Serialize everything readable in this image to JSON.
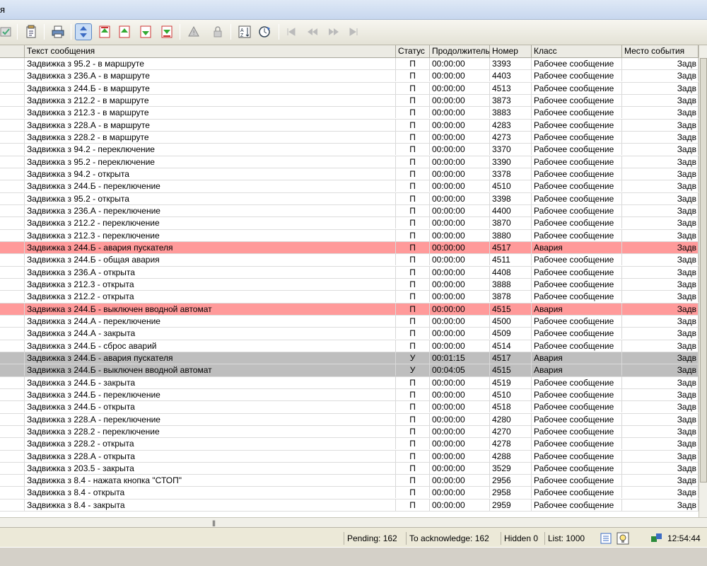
{
  "window": {
    "title": "я"
  },
  "toolbar": {
    "icons": [
      "check-list-icon",
      "properties-icon",
      "print-icon",
      "autoscroll-icon",
      "first-page-icon",
      "previous-page-icon",
      "next-page-icon",
      "last-page-icon",
      "alarm-bell-icon",
      "lock-icon",
      "sort-icon",
      "time-jump-icon",
      "nav-first-icon",
      "nav-prev-icon",
      "nav-next-icon",
      "nav-last-icon"
    ]
  },
  "columns": [
    "",
    "Текст сообщения",
    "Статус",
    "Продолжительность",
    "Номер",
    "Класс",
    "Место события"
  ],
  "rows": [
    {
      "text": "Задвижка з 95.2 - в маршруте",
      "status": "П",
      "duration": "00:00:00",
      "number": "3393",
      "cls": "Рабочее сообщение",
      "place": "Задв",
      "kind": "normal"
    },
    {
      "text": "Задвижка з 236.А - в маршруте",
      "status": "П",
      "duration": "00:00:00",
      "number": "4403",
      "cls": "Рабочее сообщение",
      "place": "Задв",
      "kind": "normal"
    },
    {
      "text": "Задвижка з 244.Б - в маршруте",
      "status": "П",
      "duration": "00:00:00",
      "number": "4513",
      "cls": "Рабочее сообщение",
      "place": "Задв",
      "kind": "normal"
    },
    {
      "text": "Задвижка з 212.2 - в маршруте",
      "status": "П",
      "duration": "00:00:00",
      "number": "3873",
      "cls": "Рабочее сообщение",
      "place": "Задв",
      "kind": "normal"
    },
    {
      "text": "Задвижка з 212.3 - в маршруте",
      "status": "П",
      "duration": "00:00:00",
      "number": "3883",
      "cls": "Рабочее сообщение",
      "place": "Задв",
      "kind": "normal"
    },
    {
      "text": "Задвижка з 228.А - в маршруте",
      "status": "П",
      "duration": "00:00:00",
      "number": "4283",
      "cls": "Рабочее сообщение",
      "place": "Задв",
      "kind": "normal"
    },
    {
      "text": "Задвижка з 228.2 - в маршруте",
      "status": "П",
      "duration": "00:00:00",
      "number": "4273",
      "cls": "Рабочее сообщение",
      "place": "Задв",
      "kind": "normal"
    },
    {
      "text": "Задвижка з 94.2 - переключение",
      "status": "П",
      "duration": "00:00:00",
      "number": "3370",
      "cls": "Рабочее сообщение",
      "place": "Задв",
      "kind": "normal"
    },
    {
      "text": "Задвижка з 95.2 - переключение",
      "status": "П",
      "duration": "00:00:00",
      "number": "3390",
      "cls": "Рабочее сообщение",
      "place": "Задв",
      "kind": "normal"
    },
    {
      "text": "Задвижка з 94.2 - открыта",
      "status": "П",
      "duration": "00:00:00",
      "number": "3378",
      "cls": "Рабочее сообщение",
      "place": "Задв",
      "kind": "normal"
    },
    {
      "text": "Задвижка з 244.Б - переключение",
      "status": "П",
      "duration": "00:00:00",
      "number": "4510",
      "cls": "Рабочее сообщение",
      "place": "Задв",
      "kind": "normal"
    },
    {
      "text": "Задвижка з 95.2 - открыта",
      "status": "П",
      "duration": "00:00:00",
      "number": "3398",
      "cls": "Рабочее сообщение",
      "place": "Задв",
      "kind": "normal"
    },
    {
      "text": "Задвижка з 236.А - переключение",
      "status": "П",
      "duration": "00:00:00",
      "number": "4400",
      "cls": "Рабочее сообщение",
      "place": "Задв",
      "kind": "normal"
    },
    {
      "text": "Задвижка з 212.2 - переключение",
      "status": "П",
      "duration": "00:00:00",
      "number": "3870",
      "cls": "Рабочее сообщение",
      "place": "Задв",
      "kind": "normal"
    },
    {
      "text": "Задвижка з 212.3 - переключение",
      "status": "П",
      "duration": "00:00:00",
      "number": "3880",
      "cls": "Рабочее сообщение",
      "place": "Задв",
      "kind": "normal"
    },
    {
      "text": "Задвижка з 244.Б - авария пускателя",
      "status": "П",
      "duration": "00:00:00",
      "number": "4517",
      "cls": "Авария",
      "place": "Задв",
      "kind": "alarm"
    },
    {
      "text": "Задвижка з 244.Б - общая авария",
      "status": "П",
      "duration": "00:00:00",
      "number": "4511",
      "cls": "Рабочее сообщение",
      "place": "Задв",
      "kind": "normal"
    },
    {
      "text": "Задвижка з 236.А - открыта",
      "status": "П",
      "duration": "00:00:00",
      "number": "4408",
      "cls": "Рабочее сообщение",
      "place": "Задв",
      "kind": "normal"
    },
    {
      "text": "Задвижка з 212.3 - открыта",
      "status": "П",
      "duration": "00:00:00",
      "number": "3888",
      "cls": "Рабочее сообщение",
      "place": "Задв",
      "kind": "normal"
    },
    {
      "text": "Задвижка з 212.2 - открыта",
      "status": "П",
      "duration": "00:00:00",
      "number": "3878",
      "cls": "Рабочее сообщение",
      "place": "Задв",
      "kind": "normal"
    },
    {
      "text": "Задвижка з 244.Б - выключен вводной автомат",
      "status": "П",
      "duration": "00:00:00",
      "number": "4515",
      "cls": "Авария",
      "place": "Задв",
      "kind": "alarm"
    },
    {
      "text": "Задвижка з 244.А - переключение",
      "status": "П",
      "duration": "00:00:00",
      "number": "4500",
      "cls": "Рабочее сообщение",
      "place": "Задв",
      "kind": "normal"
    },
    {
      "text": "Задвижка з 244.А - закрыта",
      "status": "П",
      "duration": "00:00:00",
      "number": "4509",
      "cls": "Рабочее сообщение",
      "place": "Задв",
      "kind": "normal"
    },
    {
      "text": "Задвижка з 244.Б - сброс аварий",
      "status": "П",
      "duration": "00:00:00",
      "number": "4514",
      "cls": "Рабочее сообщение",
      "place": "Задв",
      "kind": "normal"
    },
    {
      "text": "Задвижка з 244.Б - авария пускателя",
      "status": "У",
      "duration": "00:01:15",
      "number": "4517",
      "cls": "Авария",
      "place": "Задв",
      "kind": "ack"
    },
    {
      "text": "Задвижка з 244.Б - выключен вводной автомат",
      "status": "У",
      "duration": "00:04:05",
      "number": "4515",
      "cls": "Авария",
      "place": "Задв",
      "kind": "ack"
    },
    {
      "text": "Задвижка з 244.Б - закрыта",
      "status": "П",
      "duration": "00:00:00",
      "number": "4519",
      "cls": "Рабочее сообщение",
      "place": "Задв",
      "kind": "normal"
    },
    {
      "text": "Задвижка з 244.Б - переключение",
      "status": "П",
      "duration": "00:00:00",
      "number": "4510",
      "cls": "Рабочее сообщение",
      "place": "Задв",
      "kind": "normal"
    },
    {
      "text": "Задвижка з 244.Б - открыта",
      "status": "П",
      "duration": "00:00:00",
      "number": "4518",
      "cls": "Рабочее сообщение",
      "place": "Задв",
      "kind": "normal"
    },
    {
      "text": "Задвижка з 228.А - переключение",
      "status": "П",
      "duration": "00:00:00",
      "number": "4280",
      "cls": "Рабочее сообщение",
      "place": "Задв",
      "kind": "normal"
    },
    {
      "text": "Задвижка з 228.2 - переключение",
      "status": "П",
      "duration": "00:00:00",
      "number": "4270",
      "cls": "Рабочее сообщение",
      "place": "Задв",
      "kind": "normal"
    },
    {
      "text": "Задвижка з 228.2 - открыта",
      "status": "П",
      "duration": "00:00:00",
      "number": "4278",
      "cls": "Рабочее сообщение",
      "place": "Задв",
      "kind": "normal"
    },
    {
      "text": "Задвижка з 228.А - открыта",
      "status": "П",
      "duration": "00:00:00",
      "number": "4288",
      "cls": "Рабочее сообщение",
      "place": "Задв",
      "kind": "normal"
    },
    {
      "text": "Задвижка з 203.5 - закрыта",
      "status": "П",
      "duration": "00:00:00",
      "number": "3529",
      "cls": "Рабочее сообщение",
      "place": "Задв",
      "kind": "normal"
    },
    {
      "text": "Задвижка з 8.4 - нажата кнопка \"СТОП\"",
      "status": "П",
      "duration": "00:00:00",
      "number": "2956",
      "cls": "Рабочее сообщение",
      "place": "Задв",
      "kind": "normal"
    },
    {
      "text": "Задвижка з 8.4 - открыта",
      "status": "П",
      "duration": "00:00:00",
      "number": "2958",
      "cls": "Рабочее сообщение",
      "place": "Задв",
      "kind": "normal"
    },
    {
      "text": "Задвижка з 8.4 - закрыта",
      "status": "П",
      "duration": "00:00:00",
      "number": "2959",
      "cls": "Рабочее сообщение",
      "place": "Задв",
      "kind": "normal"
    }
  ],
  "status_bar": {
    "pending": "Pending: 162",
    "to_acknowledge": "To acknowledge: 162",
    "hidden": "Hidden 0",
    "list": "List: 1000",
    "time": "12:54:44"
  },
  "colors": {
    "alarm_row": "#ff9a9a",
    "ack_row": "#bebebe"
  }
}
